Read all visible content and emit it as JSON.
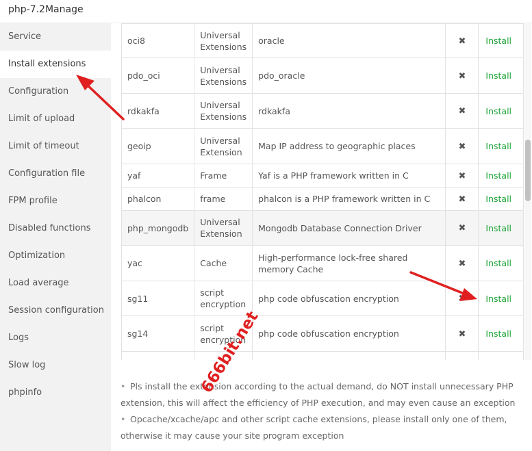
{
  "window": {
    "title": "php-7.2Manage"
  },
  "sidebar": {
    "items": [
      {
        "label": "Service"
      },
      {
        "label": "Install extensions"
      },
      {
        "label": "Configuration"
      },
      {
        "label": "Limit of upload"
      },
      {
        "label": "Limit of timeout"
      },
      {
        "label": "Configuration file"
      },
      {
        "label": "FPM profile"
      },
      {
        "label": "Disabled functions"
      },
      {
        "label": "Optimization"
      },
      {
        "label": "Load average"
      },
      {
        "label": "Session configuration"
      },
      {
        "label": "Logs"
      },
      {
        "label": "Slow log"
      },
      {
        "label": "phpinfo"
      }
    ],
    "active_label": "Install extensions"
  },
  "extensions": {
    "rows": [
      {
        "name": "oci8",
        "type": "Universal Extensions",
        "desc": "oracle",
        "status_icon": "close-icon",
        "action": "Install"
      },
      {
        "name": "pdo_oci",
        "type": "Universal Extensions",
        "desc": "pdo_oracle",
        "status_icon": "close-icon",
        "action": "Install"
      },
      {
        "name": "rdkakfa",
        "type": "Universal Extensions",
        "desc": "rdkakfa",
        "status_icon": "close-icon",
        "action": "Install"
      },
      {
        "name": "geoip",
        "type": "Universal Extension",
        "desc": "Map IP address to geographic places",
        "status_icon": "close-icon",
        "action": "Install"
      },
      {
        "name": "yaf",
        "type": "Frame",
        "desc": "Yaf is a PHP framework written in C",
        "status_icon": "close-icon",
        "action": "Install"
      },
      {
        "name": "phalcon",
        "type": "frame",
        "desc": "phalcon is a PHP framework written in C",
        "status_icon": "close-icon",
        "action": "Install"
      },
      {
        "name": "php_mongodb",
        "type": "Universal Extension",
        "desc": "Mongodb Database Connection Driver",
        "status_icon": "close-icon",
        "action": "Install"
      },
      {
        "name": "yac",
        "type": "Cache",
        "desc": "High-performance lock-free shared memory Cache",
        "status_icon": "close-icon",
        "action": "Install"
      },
      {
        "name": "sg11",
        "type": "script encryption",
        "desc": "php code obfuscation encryption",
        "status_icon": "close-icon",
        "action": "Install"
      },
      {
        "name": "sg14",
        "type": "script encryption",
        "desc": "php code obfuscation encryption",
        "status_icon": "close-icon",
        "action": "Install"
      }
    ],
    "highlighted_row": "php_mongodb",
    "status_icon_glyph": "✖"
  },
  "notes": [
    "Pls install the extension according to the actual demand, do NOT install unnecessary PHP extension, this will affect the efficiency of PHP execution, and may even cause an exception",
    "Opcache/xcache/apc and other script cache extensions, please install only one of them, otherwise it may cause your site program exception"
  ],
  "watermark": {
    "text": "666bit.net"
  },
  "colors": {
    "install_link": "#20a53a",
    "annotation_arrow": "#e02020",
    "sidebar_bg": "#f2f2f2"
  }
}
